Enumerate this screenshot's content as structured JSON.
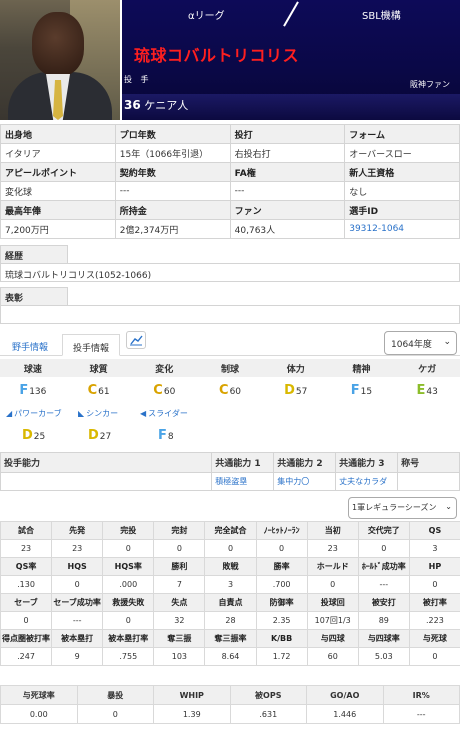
{
  "header": {
    "league": "αリーグ",
    "team": "SBL機構",
    "player_name": "琉球コバルトリコリス",
    "position": "投 手",
    "fan": "阪神ファン",
    "number": "36",
    "nationality": "ケニア人"
  },
  "info_rows": [
    [
      {
        "t": "出身地",
        "h": true
      },
      {
        "t": "プロ年数",
        "h": true
      },
      {
        "t": "投打",
        "h": true
      },
      {
        "t": "フォーム",
        "h": true
      }
    ],
    [
      {
        "t": "イタリア"
      },
      {
        "t": "15年（1066年引退）"
      },
      {
        "t": "右投右打"
      },
      {
        "t": "オーバースロー"
      }
    ],
    [
      {
        "t": "アピールポイント",
        "h": true
      },
      {
        "t": "契約年数",
        "h": true
      },
      {
        "t": "FA権",
        "h": true
      },
      {
        "t": "新人王資格",
        "h": true
      }
    ],
    [
      {
        "t": "変化球"
      },
      {
        "t": "---"
      },
      {
        "t": "---"
      },
      {
        "t": "なし"
      }
    ],
    [
      {
        "t": "最高年俸",
        "h": true
      },
      {
        "t": "所持金",
        "h": true
      },
      {
        "t": "ファン",
        "h": true
      },
      {
        "t": "選手ID",
        "h": true
      }
    ],
    [
      {
        "t": "7,200万円"
      },
      {
        "t": "2億2,374万円"
      },
      {
        "t": "40,763人"
      },
      {
        "t": "39312-1064",
        "link": true
      }
    ]
  ],
  "career": {
    "label": "経歴",
    "value": "琉球コバルトリコリス(1052-1066)"
  },
  "awards": {
    "label": "表彰",
    "value": ""
  },
  "tabs": {
    "fielder": "野手情報",
    "pitcher": "投手情報",
    "chart_icon": "chart-icon"
  },
  "year_select": "1064年度",
  "abilities": {
    "headers": [
      "球速",
      "球質",
      "変化",
      "制球",
      "体力",
      "精神",
      "ケガ"
    ],
    "values": [
      {
        "rank": "F",
        "v": "136",
        "c": "rF"
      },
      {
        "rank": "C",
        "v": "61",
        "c": "rC"
      },
      {
        "rank": "C",
        "v": "60",
        "c": "rC"
      },
      {
        "rank": "C",
        "v": "60",
        "c": "rC"
      },
      {
        "rank": "D",
        "v": "57",
        "c": "rD"
      },
      {
        "rank": "F",
        "v": "15",
        "c": "rF"
      },
      {
        "rank": "E",
        "v": "43",
        "c": "rE"
      }
    ]
  },
  "pitches": [
    {
      "name": "パワーカーブ",
      "arrow": "◢",
      "rank": "D",
      "v": "25",
      "c": "rD"
    },
    {
      "name": "シンカー",
      "arrow": "◣",
      "rank": "D",
      "v": "27",
      "c": "rD"
    },
    {
      "name": "スライダー",
      "arrow": "◀",
      "rank": "F",
      "v": "8",
      "c": "rF"
    }
  ],
  "pitcher_ability": {
    "headers": [
      "投手能力",
      "共通能力 1",
      "共通能力 2",
      "共通能力 3",
      "称号"
    ],
    "values": [
      "",
      "積極盗塁",
      "集中力〇",
      "丈夫なカラダ",
      ""
    ]
  },
  "stats_select": "1軍レギュラーシーズン",
  "stats": [
    {
      "h": [
        "試合",
        "先発",
        "完投",
        "完封",
        "完全試合",
        "ﾉｰﾋｯﾄﾉｰﾗﾝ",
        "当初",
        "交代完了",
        "QS"
      ],
      "v": [
        "23",
        "23",
        "0",
        "0",
        "0",
        "0",
        "23",
        "0",
        "3"
      ]
    },
    {
      "h": [
        "QS率",
        "HQS",
        "HQS率",
        "勝利",
        "敗戦",
        "勝率",
        "ホールド",
        "ﾎｰﾙﾄﾞ成功率",
        "HP"
      ],
      "v": [
        ".130",
        "0",
        ".000",
        "7",
        "3",
        ".700",
        "0",
        "---",
        "0"
      ]
    },
    {
      "h": [
        "セーブ",
        "セーブ成功率",
        "救援失敗",
        "失点",
        "自責点",
        "防御率",
        "投球回",
        "被安打",
        "被打率"
      ],
      "v": [
        "0",
        "---",
        "0",
        "32",
        "28",
        "2.35",
        "107回1/3",
        "89",
        ".223"
      ]
    },
    {
      "h": [
        "得点圏被打率",
        "被本塁打",
        "被本塁打率",
        "奪三振",
        "奪三振率",
        "K/BB",
        "与四球",
        "与四球率",
        "与死球"
      ],
      "v": [
        ".247",
        "9",
        ".755",
        "103",
        "8.64",
        "1.72",
        "60",
        "5.03",
        "0"
      ]
    }
  ],
  "stats_last": {
    "h": [
      "与死球率",
      "暴投",
      "WHIP",
      "被OPS",
      "GO/AO",
      "IR%"
    ],
    "v": [
      "0.00",
      "0",
      "1.39",
      ".631",
      "1.446",
      "---"
    ]
  }
}
